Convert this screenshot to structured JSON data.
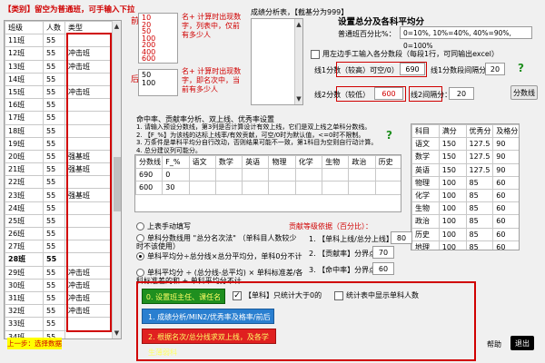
{
  "header": {
    "hint": "【类别】留空为普通班，可手输入下拉"
  },
  "left_table": {
    "columns": [
      "班级",
      "人数",
      "类型"
    ],
    "rows": [
      [
        "11班",
        "55",
        ""
      ],
      [
        "12班",
        "55",
        "冲击班"
      ],
      [
        "13班",
        "55",
        "冲击班"
      ],
      [
        "14班",
        "55",
        ""
      ],
      [
        "15班",
        "55",
        "冲击班"
      ],
      [
        "16班",
        "55",
        ""
      ],
      [
        "17班",
        "55",
        ""
      ],
      [
        "18班",
        "55",
        ""
      ],
      [
        "19班",
        "55",
        ""
      ],
      [
        "20班",
        "55",
        "强基班"
      ],
      [
        "21班",
        "55",
        "强基班"
      ],
      [
        "22班",
        "55",
        ""
      ],
      [
        "23班",
        "55",
        "强基班"
      ],
      [
        "24班",
        "55",
        ""
      ],
      [
        "25班",
        "55",
        ""
      ],
      [
        "26班",
        "55",
        ""
      ],
      [
        "27班",
        "55",
        ""
      ],
      [
        "28班",
        "55",
        ""
      ],
      [
        "29班",
        "55",
        "冲击班"
      ],
      [
        "30班",
        "55",
        "冲击班"
      ],
      [
        "31班",
        "55",
        "冲击班"
      ],
      [
        "32班",
        "55",
        "冲击班"
      ],
      [
        "33班",
        "55",
        ""
      ],
      [
        "34班",
        "55",
        ""
      ],
      [
        "35班",
        "55",
        ""
      ],
      [
        "36班",
        "55",
        ""
      ]
    ]
  },
  "list_top": {
    "label": "前",
    "items": [
      "10",
      "20",
      "50",
      "100",
      "200",
      "400",
      "600"
    ],
    "note": "名+ 计算时出现数字，列表中，仅前有多少人"
  },
  "list_bottom": {
    "label": "后",
    "items": [
      "50",
      "100"
    ],
    "note": "名+ 计算时出现数字，即名次中，当前有多少人"
  },
  "segments": {
    "label": "成绩分析表，【截基分为999】"
  },
  "settings": {
    "title": "设置总分及各科平均分",
    "percent_label": "普通班百分比%：",
    "percent_value": "0=10%, 10%=40%, 40%=90%, 0=100%",
    "checkbox_label": "用左边手工输入各分数段（每段1行，可同输出excel）",
    "line1_label": "线1分数（较高）可空/0）",
    "line1_value": "690",
    "step1_label": "线1分数段间隔分：",
    "step1_value": "20",
    "line2_label": "线2分数（较低）",
    "line2_value": "600",
    "step2_label": "线2间隔分：",
    "step2_value": "20",
    "segment_button": "分数线"
  },
  "mid": {
    "title": "命中率、贡献率分析、双上线、优秀率设置",
    "notes": [
      "1. 请输入预设分数线，第3列是否计算设计有效上线，它们是双上线之单科分数线。",
      "2. 【F_%】为该线的达标上线率/有效贡献，可空/0时为默认值，<=0时不限制。",
      "3. 万条件是单科平均分自行改动，否则结果可能不一致，第1科目为空则自行动计算。",
      "4. 总分建议列可能分。"
    ],
    "help": "?",
    "columns": [
      "分数线",
      "F_%",
      "语文",
      "数学",
      "英语",
      "物理",
      "化学",
      "生物",
      "政治",
      "历史"
    ],
    "rows": [
      [
        "690",
        "0",
        "",
        "",
        "",
        "",
        "",
        "",
        "",
        ""
      ],
      [
        "600",
        "30",
        "",
        "",
        "",
        "",
        "",
        "",
        "",
        ""
      ]
    ]
  },
  "subject_table": {
    "columns": [
      "科目",
      "满分",
      "优秀分",
      "及格分"
    ],
    "rows": [
      [
        "语文",
        "150",
        "127.5",
        "90"
      ],
      [
        "数学",
        "150",
        "127.5",
        "90"
      ],
      [
        "英语",
        "150",
        "127.5",
        "90"
      ],
      [
        "物理",
        "100",
        "85",
        "60"
      ],
      [
        "化学",
        "100",
        "85",
        "60"
      ],
      [
        "生物",
        "100",
        "85",
        "60"
      ],
      [
        "政治",
        "100",
        "85",
        "60"
      ],
      [
        "历史",
        "100",
        "85",
        "60"
      ],
      [
        "地理",
        "100",
        "85",
        "60"
      ]
    ],
    "help": "?"
  },
  "options": {
    "radio1": "上表手动填写",
    "radio2": "单科分数线用 \"总分名次法\" （单科目人数较少时不该使用）",
    "radio3": "单科平均分÷总分线×总分平均分，单科0分不计",
    "radio4": "单科平均分 ÷ (总分线-总平均) × 单科标准差/各科标准差的和 + 单科平均分不计",
    "grade_title": "贡献等级依据（百分比）：",
    "grade1_label": "1. 【单科上线/总分上线】：",
    "grade1_value": "80",
    "grade2_label": "2. 【贡献率】分界点：",
    "grade2_value": "70",
    "grade3_label": "3. 【命中率】分界点：",
    "grade3_value": "60"
  },
  "bottom": {
    "step0": "0. 设置班主任、课任名师",
    "chk_single": "【单科】只统计大于0的",
    "chk_stats": "统计表中显示单科人数",
    "step1": "1. 成绩分析/MIN2/优秀率及格率/前后x名",
    "step2": "2. 根据名次/总分线求双上线，及各学生薄弱科",
    "prev_step": "上一步：选择数据",
    "help": "帮助",
    "exit": "退出"
  },
  "colors": {
    "red": "#d00000",
    "green_button": "#1f8f1f",
    "blue_button": "#2a7fd0",
    "red_button": "#e02020",
    "yellow_button": "#ffff00"
  }
}
